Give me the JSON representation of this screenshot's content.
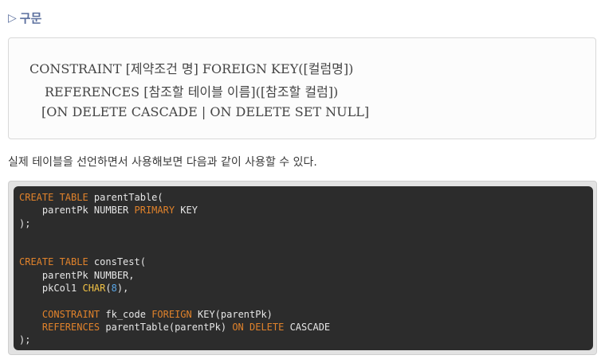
{
  "heading": {
    "icon": "triangle-right-icon",
    "text": "구문"
  },
  "syntax": {
    "lines": [
      "CONSTRAINT [제약조건 명] FOREIGN KEY([컬럼명])",
      "REFERENCES [참조할 테이블 이름]([참조할 컬럼])",
      "[ON DELETE CASCADE | ON DELETE SET NULL]"
    ]
  },
  "description": "실제 테이블을 선언하면서 사용해보면 다음과 같이 사용할 수 있다.",
  "code": {
    "lines": [
      [
        {
          "t": "CREATE TABLE",
          "c": "kw"
        },
        {
          "t": " parentTable(",
          "c": "tx"
        }
      ],
      [
        {
          "t": "    parentPk NUMBER ",
          "c": "tx"
        },
        {
          "t": "PRIMARY",
          "c": "kw"
        },
        {
          "t": " KEY",
          "c": "tx"
        }
      ],
      [
        {
          "t": ");",
          "c": "tx"
        }
      ],
      [],
      [],
      [
        {
          "t": "CREATE TABLE",
          "c": "kw"
        },
        {
          "t": " consTest(",
          "c": "tx"
        }
      ],
      [
        {
          "t": "    parentPk NUMBER,",
          "c": "tx"
        }
      ],
      [
        {
          "t": "    pkCol1 ",
          "c": "tx"
        },
        {
          "t": "CHAR",
          "c": "fn"
        },
        {
          "t": "(",
          "c": "tx"
        },
        {
          "t": "8",
          "c": "num"
        },
        {
          "t": "),",
          "c": "tx"
        }
      ],
      [],
      [
        {
          "t": "    ",
          "c": "tx"
        },
        {
          "t": "CONSTRAINT",
          "c": "kw"
        },
        {
          "t": " fk_code ",
          "c": "tx"
        },
        {
          "t": "FOREIGN",
          "c": "kw"
        },
        {
          "t": " KEY(parentPk)",
          "c": "tx"
        }
      ],
      [
        {
          "t": "    ",
          "c": "tx"
        },
        {
          "t": "REFERENCES",
          "c": "kw"
        },
        {
          "t": " parentTable(parentPk) ",
          "c": "tx"
        },
        {
          "t": "ON DELETE",
          "c": "kw"
        },
        {
          "t": " CASCADE",
          "c": "tx"
        }
      ],
      [
        {
          "t": ");",
          "c": "tx"
        }
      ]
    ]
  },
  "colors": {
    "heading": "#5b6f9e",
    "code_bg": "#2c2c2c",
    "keyword": "#e0822b",
    "function": "#f0c145",
    "number": "#5aa6e6",
    "text": "#e6e6e6"
  }
}
